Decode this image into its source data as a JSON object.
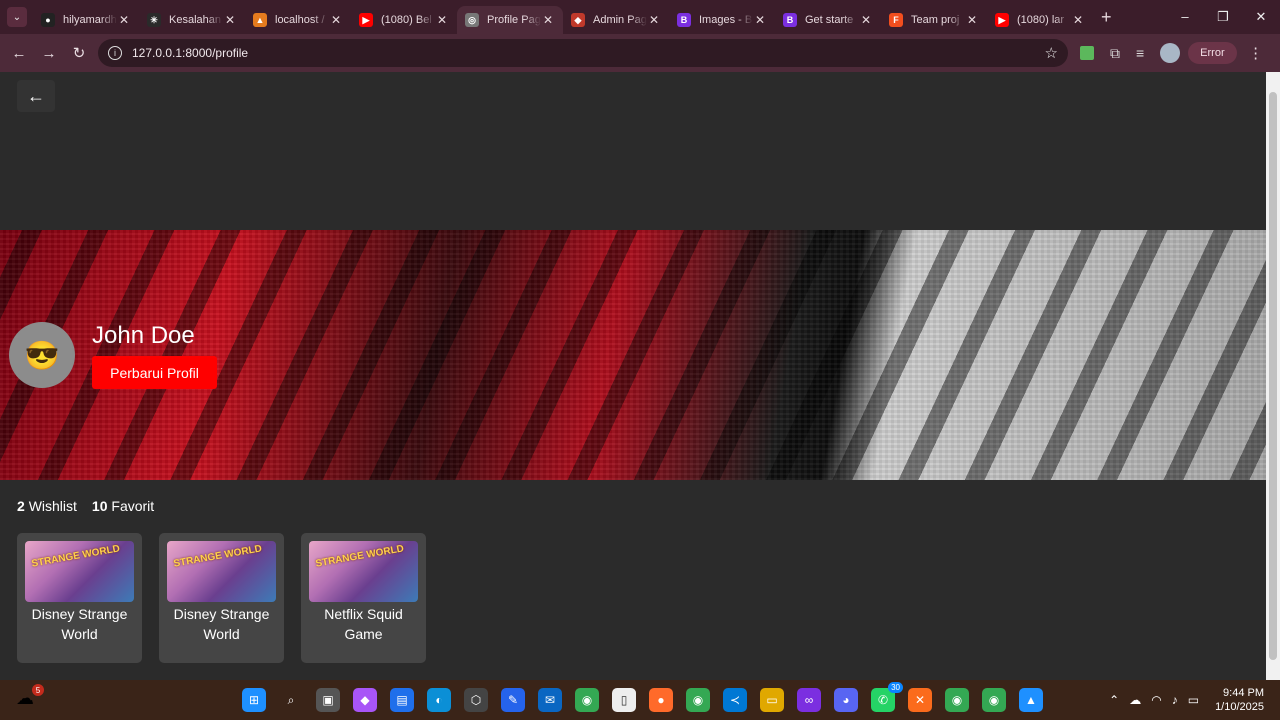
{
  "browser": {
    "tabs": [
      {
        "title": "hilyamardh",
        "fav_color": "#222222",
        "fav_glyph": "●"
      },
      {
        "title": "Kesalahan",
        "fav_color": "#2a2a2a",
        "fav_glyph": "✳"
      },
      {
        "title": "localhost /",
        "fav_color": "#e57b1e",
        "fav_glyph": "▲"
      },
      {
        "title": "(1080) Bel",
        "fav_color": "#ff0000",
        "fav_glyph": "▶"
      },
      {
        "title": "Profile Pag",
        "fav_color": "#777777",
        "fav_glyph": "◎"
      },
      {
        "title": "Admin Pag",
        "fav_color": "#c0392b",
        "fav_glyph": "◆"
      },
      {
        "title": "Images - B",
        "fav_color": "#7b2fe0",
        "fav_glyph": "B"
      },
      {
        "title": "Get starte",
        "fav_color": "#7b2fe0",
        "fav_glyph": "B"
      },
      {
        "title": "Team proj",
        "fav_color": "#f24e1e",
        "fav_glyph": "F"
      },
      {
        "title": "(1080) lar",
        "fav_color": "#ff0000",
        "fav_glyph": "▶"
      }
    ],
    "url": "127.0.0.1:8000/profile",
    "error_label": "Error"
  },
  "page": {
    "back_glyph": "←",
    "profile": {
      "name": "John Doe",
      "avatar_glyph": "😎",
      "update_button": "Perbarui Profil"
    },
    "stats": {
      "wishlist_count": "2",
      "wishlist_label": "Wishlist",
      "favorite_count": "10",
      "favorite_label": "Favorit"
    },
    "cards": [
      {
        "title": "Disney Strange World",
        "thumb_text": "STRANGE WORLD"
      },
      {
        "title": "Disney Strange World",
        "thumb_text": "STRANGE WORLD"
      },
      {
        "title": "Netflix Squid Game",
        "thumb_text": "STRANGE WORLD"
      }
    ]
  },
  "taskbar": {
    "weather_badge": "5",
    "whatsapp_badge": "30",
    "time": "9:44 PM",
    "date": "1/10/2025"
  }
}
